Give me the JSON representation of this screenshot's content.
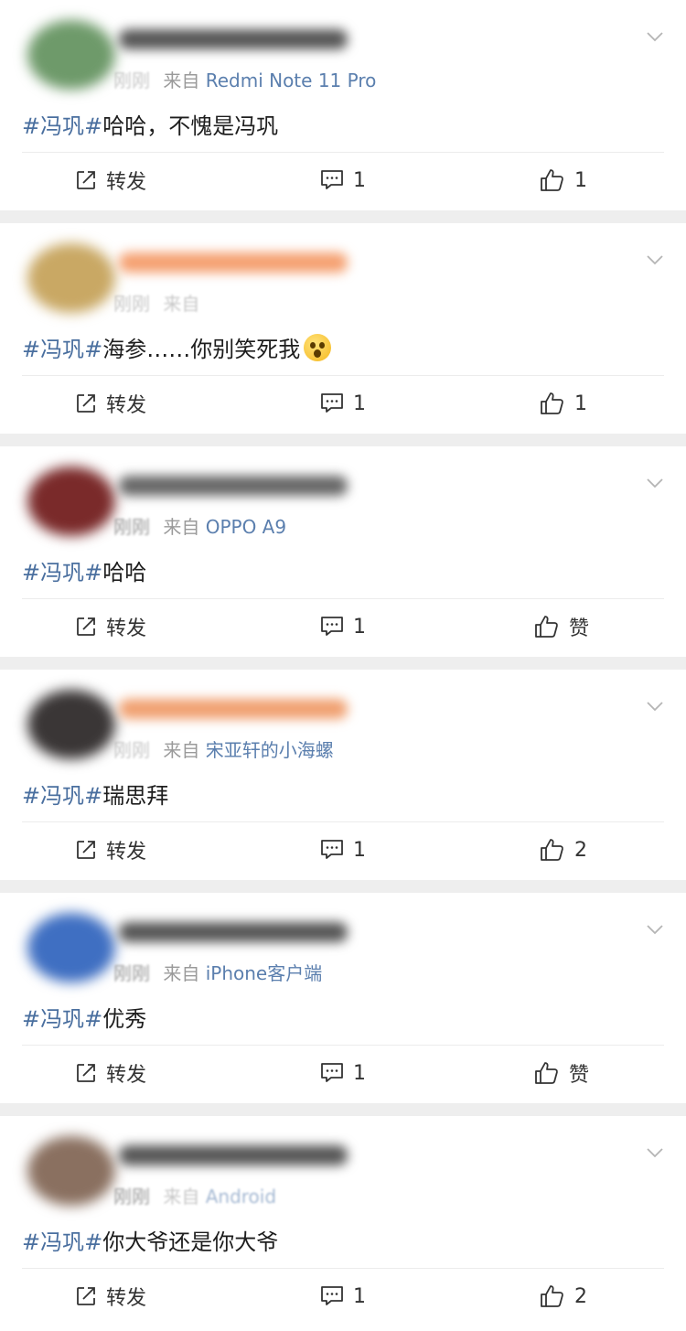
{
  "labels": {
    "forward": "转发",
    "like_zero": "赞"
  },
  "posts": [
    {
      "time": "刚刚",
      "source_prefix": "来自",
      "source": "Redmi Note 11 Pro",
      "topic": "#冯巩#",
      "text": "哈哈，不愧是冯巩",
      "comments": "1",
      "likes": "1",
      "avatar_color": "#6e9a6a",
      "name_color": "#555555"
    },
    {
      "time": "刚刚",
      "source_prefix": "来自",
      "source": "",
      "topic": "#冯巩#",
      "text": " 海参……你别笑死我",
      "emoji": "astonished-face",
      "comments": "1",
      "likes": "1",
      "avatar_color": "#c9a864",
      "name_color": "#f5a070"
    },
    {
      "time": "刚刚",
      "source_prefix": "来自",
      "source": "OPPO A9",
      "topic": "#冯巩#",
      "text": "哈哈",
      "comments": "1",
      "likes": "赞",
      "avatar_color": "#7a2a2a",
      "name_color": "#666666"
    },
    {
      "time": "刚刚",
      "source_prefix": "来自",
      "source": "宋亚轩的小海螺",
      "topic": "#冯巩#",
      "text": "瑞思拜",
      "comments": "1",
      "likes": "2",
      "avatar_color": "#3a3636",
      "name_color": "#f0a070"
    },
    {
      "time": "刚刚",
      "source_prefix": "来自",
      "source": "iPhone客户端",
      "topic": "#冯巩#",
      "text": "优秀",
      "comments": "1",
      "likes": "赞",
      "avatar_color": "#3f6fc2",
      "name_color": "#555555"
    },
    {
      "time": "刚刚",
      "source_prefix": "来自",
      "source": "Android",
      "topic": "#冯巩#",
      "text": "你大爷还是你大爷",
      "comments": "1",
      "likes": "2",
      "avatar_color": "#8a7060",
      "name_color": "#555555"
    }
  ]
}
